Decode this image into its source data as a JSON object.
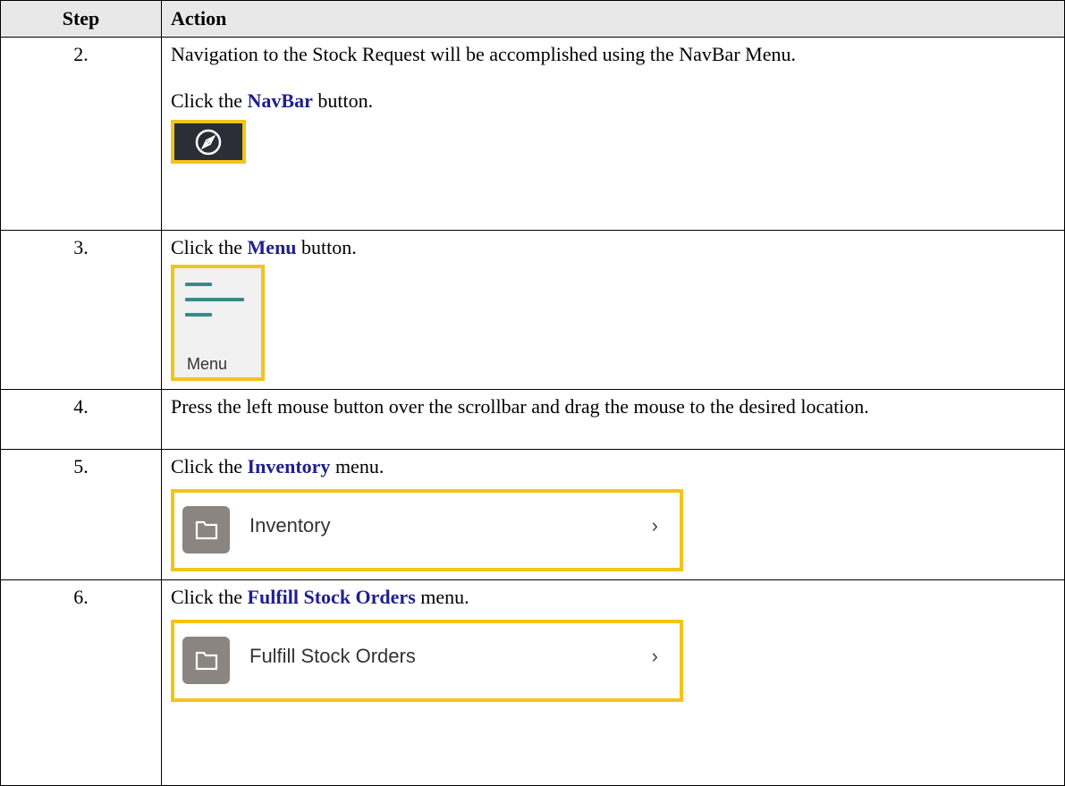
{
  "header": {
    "step": "Step",
    "action": "Action"
  },
  "rows": [
    {
      "step": "2.",
      "intro": "Navigation to the Stock Request will be accomplished using the NavBar Menu.",
      "pre": "Click the ",
      "target": "NavBar",
      "post": " button."
    },
    {
      "step": "3.",
      "pre": "Click the ",
      "target": "Menu",
      "post": " button.",
      "shot_label": "Menu"
    },
    {
      "step": "4.",
      "text": "Press the left mouse button over the scrollbar and drag the mouse to the desired location."
    },
    {
      "step": "5.",
      "pre": "Click the ",
      "target": "Inventory",
      "post": " menu.",
      "shot_label": "Inventory",
      "chevron": "›"
    },
    {
      "step": "6.",
      "pre": "Click the ",
      "target": "Fulfill Stock Orders",
      "post": " menu.",
      "shot_label": "Fulfill Stock Orders",
      "chevron": "›"
    }
  ],
  "icons": {
    "navbar": "compass-icon",
    "menu": "hamburger-menu-icon",
    "folder": "folder-icon",
    "chevron": "chevron-right-icon"
  },
  "colors": {
    "highlight": "#f3c419",
    "ui_text": "#1f1f8f",
    "header_bg": "#e8e8e8",
    "menu_lines": "#3b8a86",
    "folder_tile": "#8a8580",
    "navbar_bg": "#2b2e37"
  }
}
